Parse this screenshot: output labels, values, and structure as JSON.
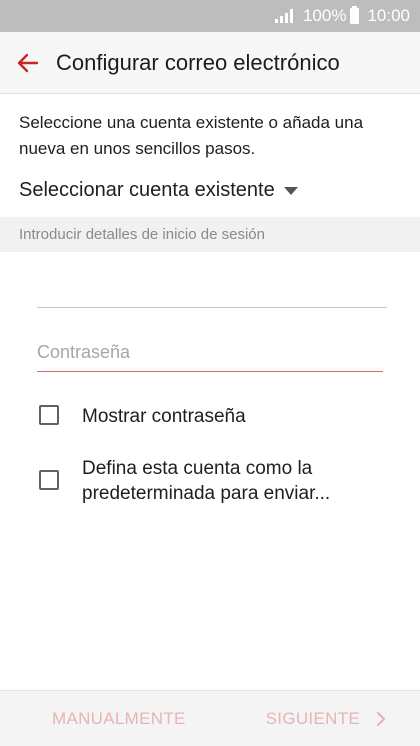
{
  "status_bar": {
    "battery_percent": "100%",
    "time": "10:00",
    "signal_icon": "signal-icon",
    "battery_icon": "battery-icon"
  },
  "app_bar": {
    "title": "Configurar correo electrónico",
    "back_icon": "arrow-left-icon",
    "accent_color": "#c62828"
  },
  "intro": {
    "description": "Seleccione una cuenta existente o añada una nueva en unos sencillos pasos.",
    "select_existing_label": "Seleccionar cuenta existente"
  },
  "login_section": {
    "header": "Introducir detalles de inicio de sesión",
    "email_value": "",
    "password_placeholder": "Contraseña",
    "password_value": "",
    "show_password_label": "Mostrar contraseña",
    "show_password_checked": false,
    "default_account_label_line1": "Defina esta cuenta como la",
    "default_account_label_line2": "predeterminada para enviar...",
    "default_account_checked": false
  },
  "bottom_bar": {
    "manual_label": "MANUALMENTE",
    "next_label": "SIGUIENTE",
    "next_icon": "chevron-right-icon",
    "disabled_color": "#e5b5b5"
  }
}
